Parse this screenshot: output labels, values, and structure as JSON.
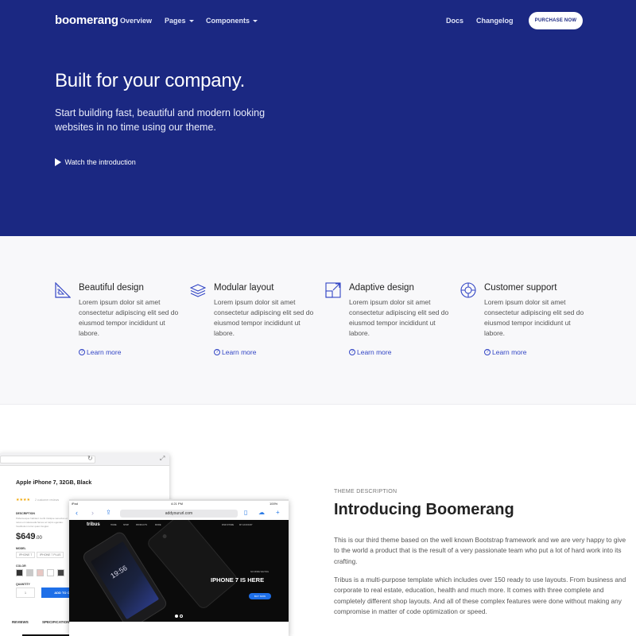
{
  "nav": {
    "logo": "boomerang",
    "links": [
      "Overview",
      "Pages",
      "Components"
    ],
    "right_links": [
      "Docs",
      "Changelog"
    ],
    "purchase_button": "PURCHASE NOW"
  },
  "hero": {
    "title": "Built for your company.",
    "subtitle": "Start building fast, beautiful and modern looking websites in no time using our theme.",
    "watch": "Watch the introduction"
  },
  "features": [
    {
      "icon": "drafting-icon",
      "title": "Beautiful design",
      "text": "Lorem ipsum dolor sit amet consectetur adipiscing elit sed do eiusmod tempor incididunt ut labore.",
      "link": "Learn more"
    },
    {
      "icon": "layers-icon",
      "title": "Modular layout",
      "text": "Lorem ipsum dolor sit amet consectetur adipiscing elit sed do eiusmod tempor incididunt ut labore.",
      "link": "Learn more"
    },
    {
      "icon": "expand-icon",
      "title": "Adaptive design",
      "text": "Lorem ipsum dolor sit amet consectetur adipiscing elit sed do eiusmod tempor incididunt ut labore.",
      "link": "Learn more"
    },
    {
      "icon": "lifebuoy-icon",
      "title": "Customer support",
      "text": "Lorem ipsum dolor sit amet consectetur adipiscing elit sed do eiusmod tempor incididunt ut labore.",
      "link": "Learn more"
    }
  ],
  "intro": {
    "eyebrow": "THEME DESCRIPTION",
    "title": "Introducing Boomerang",
    "paragraph1": "This is our third theme based on the well known Bootstrap framework and we are very happy to give to the world a product that is the result of a very passionate team who put a lot of hard work into its crafting.",
    "paragraph2": "Tribus is a multi-purpose template which includes over 150 ready to use layouts. From business and corporate to real estate, education, health and much more. It comes with three complete and completely different shop layouts. And all of these complex features were done without making any compromise in matter of code optimization or speed."
  },
  "product_mock": {
    "title": "Apple iPhone 7, 32GB, Black",
    "stars": "★★★★",
    "reviews": "2 customer reviews",
    "description_label": "DESCRIPTION",
    "description": "Pellentesque habitant morbi tristique senectus et netus et malesuada fames ac turpis egestas. Vestibulum tortor quam feugiat.",
    "price": "$649",
    "price_cents": ".00",
    "model_label": "MODEL",
    "models": [
      "IPHONE 7",
      "IPHONE 7 PLUS"
    ],
    "color_label": "COLOR",
    "colors": [
      "#333333",
      "#c9c9c9",
      "#e8c8c4",
      "#ffffff",
      "#444444",
      "#e6c7a8"
    ],
    "quantity_label": "QUANTITY",
    "quantity": "1",
    "add_button": "ADD TO CART",
    "tabs": [
      "REVIEWS",
      "SPECIFICATIONS"
    ]
  },
  "tablet_mock": {
    "device": "iPad",
    "time": "4:21 PM",
    "battery": "100%",
    "url": "addyoururl.com",
    "brand": "tribus",
    "menu": [
      "HOME",
      "SHOP",
      "PRODUCTS",
      "MORE"
    ],
    "menu_right": [
      "FIND STORE",
      "MY ACCOUNT"
    ],
    "clock": "19:56",
    "tag": "NO MORE WAITING",
    "hero_text": "IPHONE 7 IS HERE",
    "buy_button": "BUY NOW"
  },
  "colors": {
    "hero_bg": "#1b2882",
    "accent": "#3346c5",
    "button_blue": "#1e6fe8"
  }
}
